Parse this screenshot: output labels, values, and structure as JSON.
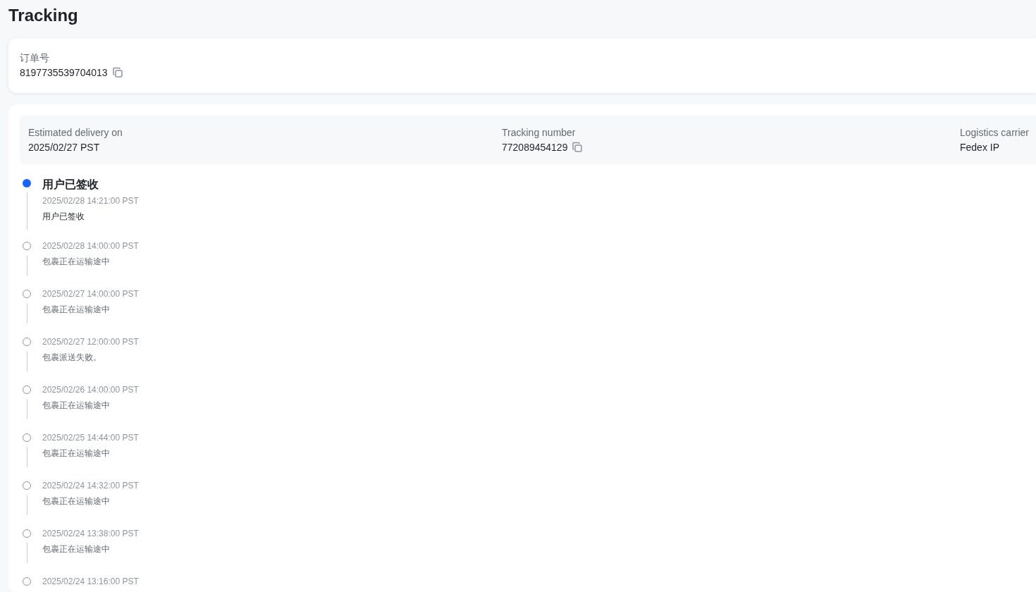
{
  "page_title": "Tracking",
  "order": {
    "label": "订单号",
    "value": "8197735539704013"
  },
  "summary": [
    {
      "label": "Estimated delivery on",
      "value": "2025/02/27 PST",
      "copyable": false
    },
    {
      "label": "Tracking number",
      "value": "772089454129",
      "copyable": true
    },
    {
      "label": "Logistics carrier",
      "value": "Fedex IP",
      "copyable": false
    }
  ],
  "events": [
    {
      "active": true,
      "status": "用户已签收",
      "time": "2025/02/28 14:21:00 PST",
      "description": "用户已签收"
    },
    {
      "active": false,
      "time": "2025/02/28 14:00:00 PST",
      "description": "包裹正在运输途中"
    },
    {
      "active": false,
      "time": "2025/02/27 14:00:00 PST",
      "description": "包裹正在运输途中"
    },
    {
      "active": false,
      "time": "2025/02/27 12:00:00 PST",
      "description": "包裹派送失败。"
    },
    {
      "active": false,
      "time": "2025/02/26 14:00:00 PST",
      "description": "包裹正在运输途中"
    },
    {
      "active": false,
      "time": "2025/02/25 14:44:00 PST",
      "description": "包裹正在运输途中"
    },
    {
      "active": false,
      "time": "2025/02/24 14:32:00 PST",
      "description": "包裹正在运输途中"
    },
    {
      "active": false,
      "time": "2025/02/24 13:38:00 PST",
      "description": "包裹正在运输途中"
    },
    {
      "active": false,
      "time": "2025/02/24 13:16:00 PST"
    }
  ]
}
